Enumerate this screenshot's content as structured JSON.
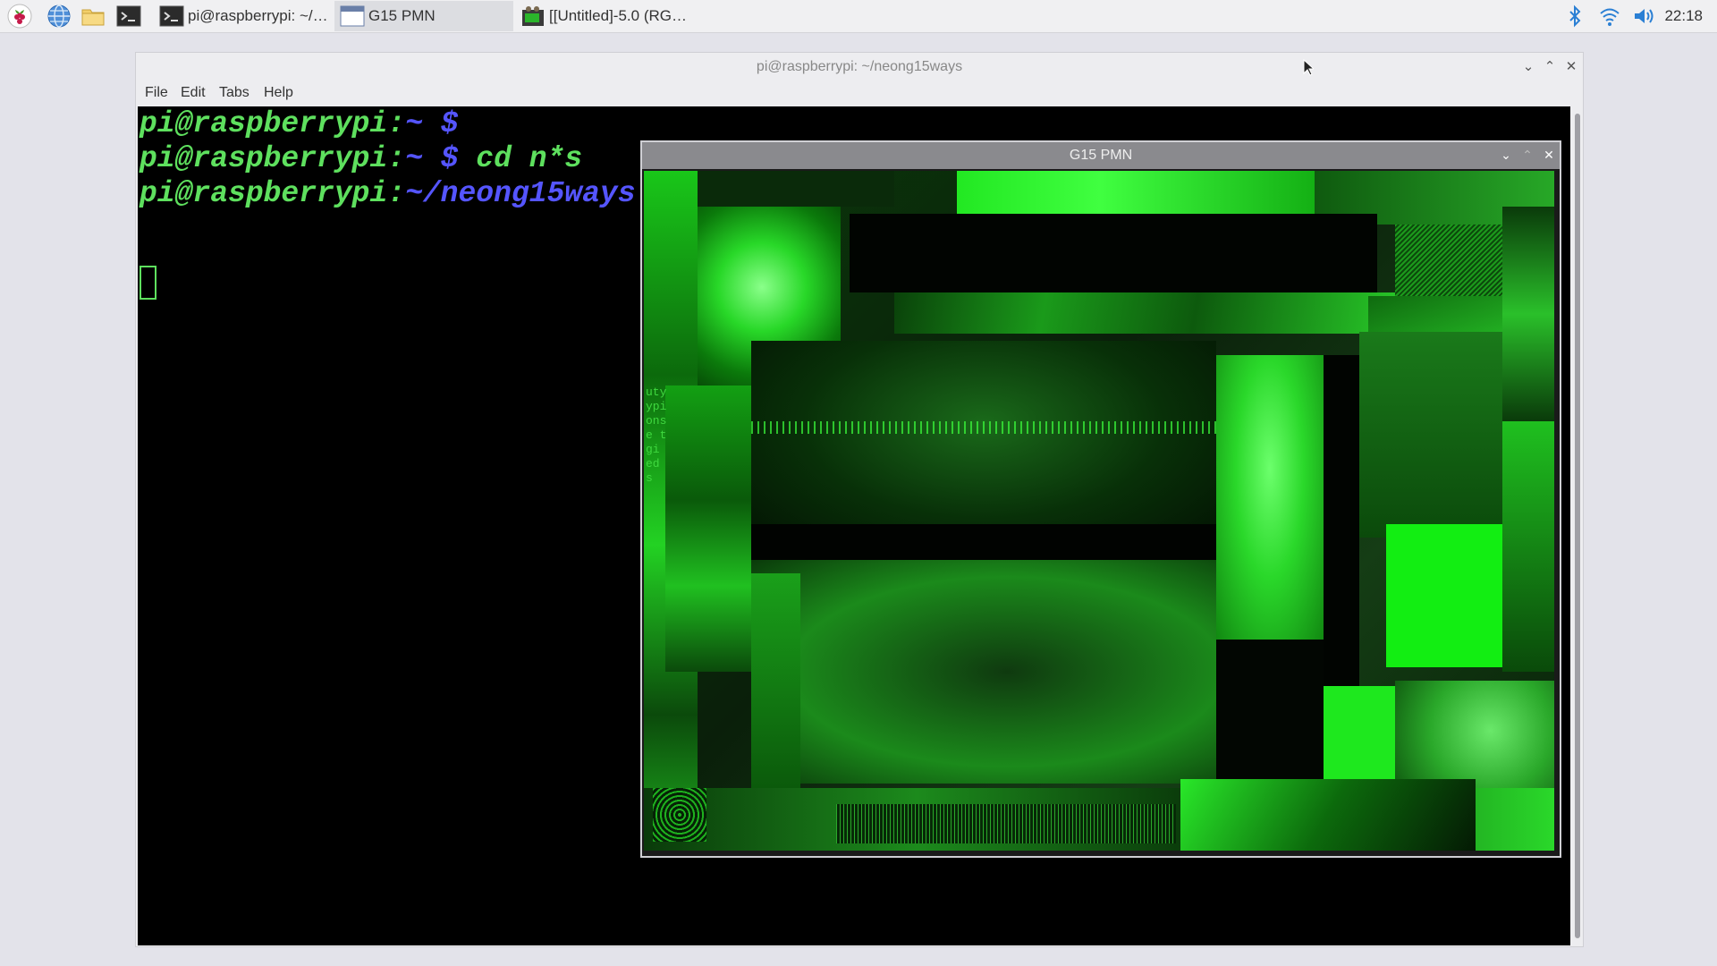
{
  "taskbar": {
    "launchers": [
      {
        "name": "menu-raspberry-icon"
      },
      {
        "name": "web-browser-icon"
      },
      {
        "name": "file-manager-icon"
      },
      {
        "name": "terminal-launcher-icon"
      }
    ],
    "tasks": [
      {
        "label": "pi@raspberrypi: ~/ne...",
        "icon": "terminal-icon"
      },
      {
        "label": "G15 PMN",
        "icon": "window-icon"
      },
      {
        "label": "[[Untitled]-5.0 (RGB c...",
        "icon": "gimp-icon"
      }
    ],
    "tray": [
      "bluetooth-icon",
      "wifi-icon",
      "volume-icon"
    ],
    "clock": "22:18"
  },
  "terminal": {
    "title": "pi@raspberrypi: ~/neong15ways",
    "menu": [
      "File",
      "Edit",
      "Tabs",
      "Help"
    ],
    "lines": [
      {
        "prompt": "pi@raspberrypi:",
        "path": "~",
        "sym": " $",
        "cmd": ""
      },
      {
        "prompt": "pi@raspberrypi:",
        "path": "~",
        "sym": " $",
        "cmd": " cd n*s"
      },
      {
        "prompt": "pi@raspberrypi:",
        "path": "~/neong15ways",
        "sym": "",
        "cmd": ""
      }
    ]
  },
  "g15": {
    "title": "G15 PMN",
    "side_text": "uty\nypi\nons\ne t\ngi\ned\ns"
  },
  "colors": {
    "terminal_green": "#5ee05e",
    "terminal_blue": "#5555ff",
    "neon_green": "#00ff00"
  }
}
